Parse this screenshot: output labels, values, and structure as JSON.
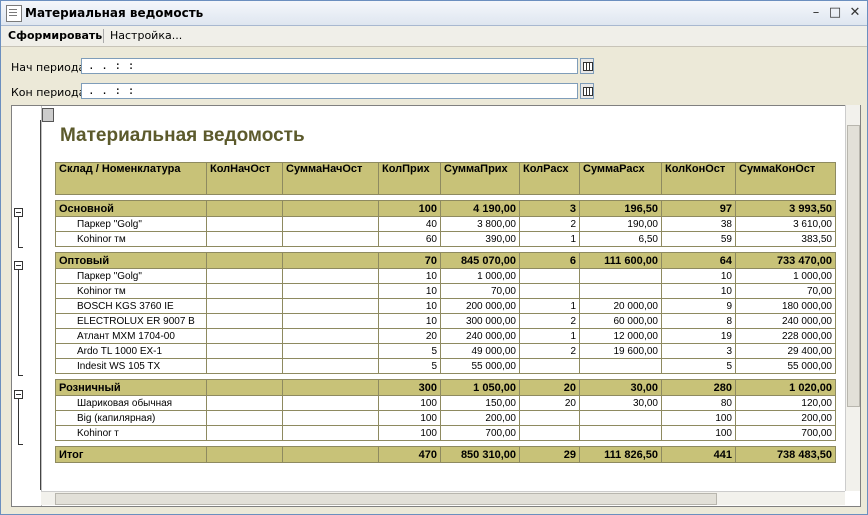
{
  "window": {
    "title": "Материальная ведомость"
  },
  "toolbar": {
    "generate_label": "Сформировать",
    "settings_label": "Настройка..."
  },
  "filters": {
    "start_label": "Нач периода",
    "start_value": " .  .    :  :",
    "end_label": "Кон периода",
    "end_value": " .  .    :  :"
  },
  "report": {
    "title": "Материальная ведомость",
    "columns": [
      "Склад / Номенклатура",
      "КолНачОст",
      "СуммаНачОст",
      "КолПрих",
      "СуммаПрих",
      "КолРасх",
      "СуммаРасх",
      "КолКонОст",
      "СуммаКонОст"
    ],
    "groups": [
      {
        "name": "Основной",
        "totals": [
          "",
          "",
          "100",
          "4 190,00",
          "3",
          "196,50",
          "97",
          "3 993,50"
        ],
        "items": [
          {
            "name": "Паркер \"Golg\"",
            "values": [
              "",
              "",
              "40",
              "3 800,00",
              "2",
              "190,00",
              "38",
              "3 610,00"
            ]
          },
          {
            "name": "Kohinor тм",
            "values": [
              "",
              "",
              "60",
              "390,00",
              "1",
              "6,50",
              "59",
              "383,50"
            ]
          }
        ]
      },
      {
        "name": "Оптовый",
        "totals": [
          "",
          "",
          "70",
          "845 070,00",
          "6",
          "111 600,00",
          "64",
          "733 470,00"
        ],
        "items": [
          {
            "name": "Паркер \"Golg\"",
            "values": [
              "",
              "",
              "10",
              "1 000,00",
              "",
              "",
              "10",
              "1 000,00"
            ]
          },
          {
            "name": "Kohinor тм",
            "values": [
              "",
              "",
              "10",
              "70,00",
              "",
              "",
              "10",
              "70,00"
            ]
          },
          {
            "name": "BOSCH KGS 3760 IE",
            "values": [
              "",
              "",
              "10",
              "200 000,00",
              "1",
              "20 000,00",
              "9",
              "180 000,00"
            ]
          },
          {
            "name": "ELECTROLUX ER 9007 B",
            "values": [
              "",
              "",
              "10",
              "300 000,00",
              "2",
              "60 000,00",
              "8",
              "240 000,00"
            ]
          },
          {
            "name": "Атлант МХМ 1704-00",
            "values": [
              "",
              "",
              "20",
              "240 000,00",
              "1",
              "12 000,00",
              "19",
              "228 000,00"
            ]
          },
          {
            "name": "Ardo TL 1000 EX-1",
            "values": [
              "",
              "",
              "5",
              "49 000,00",
              "2",
              "19 600,00",
              "3",
              "29 400,00"
            ]
          },
          {
            "name": "Indesit WS 105 TX",
            "values": [
              "",
              "",
              "5",
              "55 000,00",
              "",
              "",
              "5",
              "55 000,00"
            ]
          }
        ]
      },
      {
        "name": "Розничный",
        "totals": [
          "",
          "",
          "300",
          "1 050,00",
          "20",
          "30,00",
          "280",
          "1 020,00"
        ],
        "items": [
          {
            "name": "Шариковая обычная",
            "values": [
              "",
              "",
              "100",
              "150,00",
              "20",
              "30,00",
              "80",
              "120,00"
            ]
          },
          {
            "name": "Big (капилярная)",
            "values": [
              "",
              "",
              "100",
              "200,00",
              "",
              "",
              "100",
              "200,00"
            ]
          },
          {
            "name": "Kohinor т",
            "values": [
              "",
              "",
              "100",
              "700,00",
              "",
              "",
              "100",
              "700,00"
            ]
          }
        ]
      }
    ],
    "total": {
      "name": "Итог",
      "values": [
        "",
        "",
        "470",
        "850 310,00",
        "29",
        "111 826,50",
        "441",
        "738 483,50"
      ]
    }
  }
}
